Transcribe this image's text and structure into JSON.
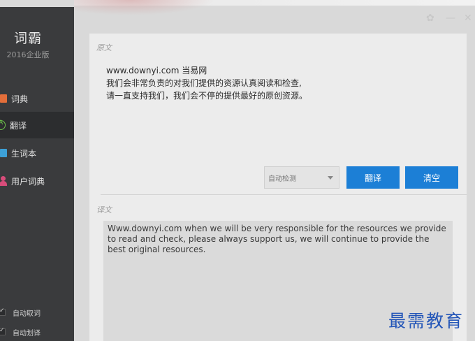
{
  "app": {
    "title": "词霸",
    "edition": "2016企业版"
  },
  "sidebar": {
    "items": [
      {
        "label": "词典",
        "icon": "dictionary-icon",
        "active": false
      },
      {
        "label": "翻译",
        "icon": "translate-icon",
        "active": true
      },
      {
        "label": "生词本",
        "icon": "vocabulary-book-icon",
        "active": false
      },
      {
        "label": "用户词典",
        "icon": "user-dictionary-icon",
        "active": false
      }
    ],
    "options": [
      {
        "label": "自动取词",
        "checked": true
      },
      {
        "label": "自动划译",
        "checked": true
      }
    ]
  },
  "window": {
    "settings_glyph": "✿",
    "minimize_glyph": "—",
    "close_glyph": "✕"
  },
  "source": {
    "label": "原文",
    "lines": [
      "www.downyi.com  当易网",
      "我们会非常负责的对我们提供的资源认真阅读和检查,",
      "请一直支持我们，我们会不停的提供最好的原创资源。"
    ]
  },
  "controls": {
    "language_select": "自动检测",
    "translate_button": "翻译",
    "clear_button": "清空"
  },
  "result": {
    "label": "译文",
    "text": "Www.downyi.com when we will be very responsible for the resources we provide to read and check, please always support us, we will continue to provide the best original resources."
  },
  "watermark": "最需教育",
  "colors": {
    "accent": "#1c7fd6",
    "sidebar": "#3a3b3d",
    "active_item": "#2c2d2f"
  }
}
